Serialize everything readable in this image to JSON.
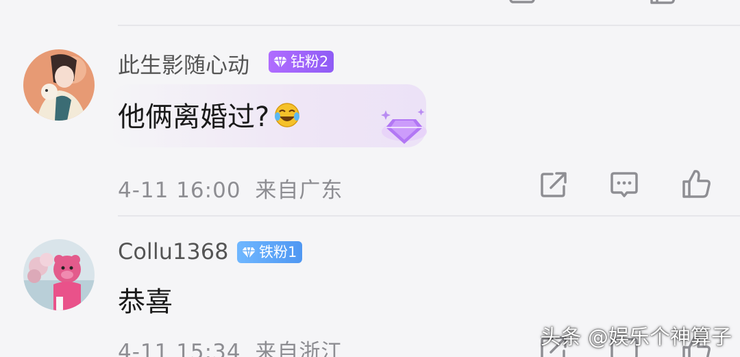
{
  "comments": [
    {
      "username": "此生影随心动",
      "badge": "钻粉2",
      "text": "他俩离婚过?",
      "date": "4-11 16:00",
      "location": "来自广东"
    },
    {
      "username": "Collu1368",
      "badge": "铁粉1",
      "text": "恭喜",
      "date": "4-11 15:34",
      "location": "来自浙江"
    }
  ],
  "colors": {
    "diamond_badge": "#9a63f7",
    "iron_badge": "#5aa5f6",
    "meta_text": "#8d8d92"
  },
  "icons": [
    "share-icon",
    "comment-icon",
    "like-icon"
  ],
  "watermark": "头条 @娱乐个神算子"
}
